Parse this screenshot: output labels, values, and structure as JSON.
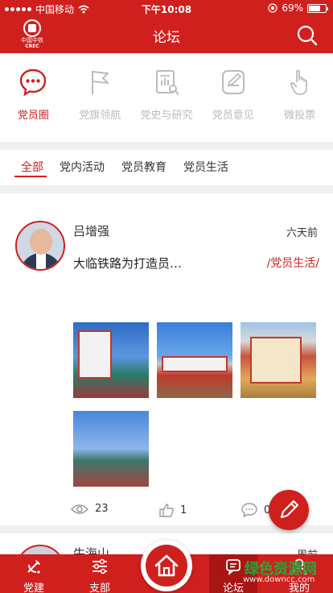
{
  "status_bar": {
    "carrier": "中国移动",
    "time": "下午10:08",
    "battery_text": "69%",
    "battery_level": 0.69
  },
  "header": {
    "logo_cn": "中国中铁",
    "logo_en": "CREC",
    "title": "论坛",
    "search_icon": "search-icon"
  },
  "categories": [
    {
      "label": "党员圈",
      "icon": "chat-bubble-icon",
      "active": true
    },
    {
      "label": "党旗领航",
      "icon": "flag-icon",
      "active": false
    },
    {
      "label": "党史与研究",
      "icon": "book-search-icon",
      "active": false
    },
    {
      "label": "党员意见",
      "icon": "edit-note-icon",
      "active": false
    },
    {
      "label": "微投票",
      "icon": "hand-tap-icon",
      "active": false
    }
  ],
  "filter_tabs": [
    {
      "label": "全部",
      "active": true
    },
    {
      "label": "党内活动",
      "active": false
    },
    {
      "label": "党员教育",
      "active": false
    },
    {
      "label": "党员生活",
      "active": false
    }
  ],
  "post": {
    "author": "吕增强",
    "time": "六天前",
    "excerpt": "大临铁路为打造员…",
    "tag": "/党员生活/",
    "views": "23",
    "likes": "1",
    "comments": "0"
  },
  "post_next": {
    "author": "牛海山",
    "time": "周前"
  },
  "bottom_nav": {
    "items": [
      {
        "label": "党建",
        "icon": "party-emblem-icon"
      },
      {
        "label": "支部",
        "icon": "sliders-icon"
      },
      {
        "label": "",
        "icon": "home-icon"
      },
      {
        "label": "论坛",
        "icon": "forum-icon"
      },
      {
        "label": "我的",
        "icon": "user-icon"
      }
    ]
  },
  "watermark": {
    "text": "绿色资源网",
    "url": "www.downcc.com"
  },
  "colors": {
    "brand_red": "#d0201e",
    "inactive_gray": "#bbbbbb"
  }
}
